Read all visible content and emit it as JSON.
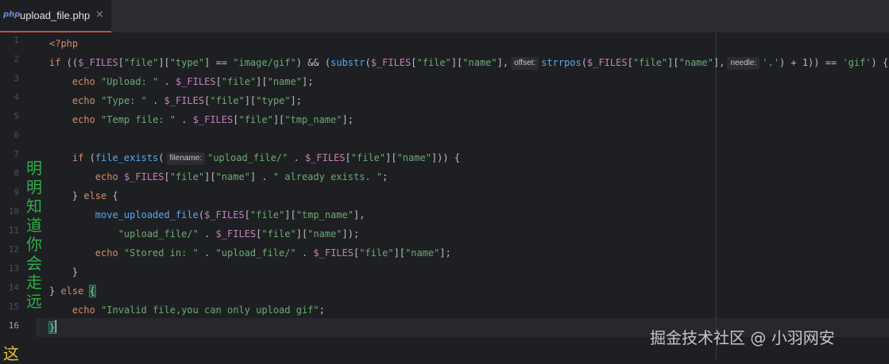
{
  "tab": {
    "icon_text": "php",
    "file_name": "upload_file.php",
    "close_glyph": "×"
  },
  "gutter": {
    "line_numbers": [
      "1",
      "2",
      "3",
      "4",
      "5",
      "6",
      "7",
      "8",
      "9",
      "10",
      "11",
      "12",
      "13",
      "14",
      "15",
      "16"
    ],
    "current_line": "16"
  },
  "code": {
    "l1": "<?php",
    "l2_if": "if",
    "l2_a": " ((",
    "l2_var1": "$_FILES",
    "l2_b": "[",
    "l2_s1": "\"file\"",
    "l2_c": "][",
    "l2_s2": "\"type\"",
    "l2_d": "] == ",
    "l2_s3": "\"image/gif\"",
    "l2_e": ") && (",
    "l2_fn1": "substr",
    "l2_f": "(",
    "l2_var2": "$_FILES",
    "l2_g": "[",
    "l2_s4": "\"file\"",
    "l2_h": "][",
    "l2_s5": "\"name\"",
    "l2_i": "],",
    "l2_hint1": "offset:",
    "l2_fn2": "strrpos",
    "l2_j": "(",
    "l2_var3": "$_FILES",
    "l2_k": "[",
    "l2_s6": "\"file\"",
    "l2_l": "][",
    "l2_s7": "\"name\"",
    "l2_m": "],",
    "l2_hint2": "needle:",
    "l2_s8": "'.'",
    "l2_n": ") + 1)) == ",
    "l2_s9": "'gif'",
    "l2_o": ") {",
    "l3_kw": "echo",
    "l3_s1": "\"Upload: \"",
    "l3_a": " . ",
    "l3_var": "$_FILES",
    "l3_b": "[",
    "l3_s2": "\"file\"",
    "l3_c": "][",
    "l3_s3": "\"name\"",
    "l3_d": "];",
    "l4_kw": "echo",
    "l4_s1": "\"Type: \"",
    "l4_a": " . ",
    "l4_var": "$_FILES",
    "l4_b": "[",
    "l4_s2": "\"file\"",
    "l4_c": "][",
    "l4_s3": "\"type\"",
    "l4_d": "];",
    "l5_kw": "echo",
    "l5_s1": "\"Temp file: \"",
    "l5_a": " . ",
    "l5_var": "$_FILES",
    "l5_b": "[",
    "l5_s2": "\"file\"",
    "l5_c": "][",
    "l5_s3": "\"tmp_name\"",
    "l5_d": "];",
    "l7_kw": "if",
    "l7_a": " (",
    "l7_fn": "file_exists",
    "l7_b": "(",
    "l7_hint": "filename:",
    "l7_s1": "\"upload_file/\"",
    "l7_c": " . ",
    "l7_var": "$_FILES",
    "l7_d": "[",
    "l7_s2": "\"file\"",
    "l7_e": "][",
    "l7_s3": "\"name\"",
    "l7_f": "])) {",
    "l8_kw": "echo",
    "l8_var": "$_FILES",
    "l8_a": "[",
    "l8_s1": "\"file\"",
    "l8_b": "][",
    "l8_s2": "\"name\"",
    "l8_c": "] . ",
    "l8_s3": "\" already exists. \"",
    "l8_d": ";",
    "l9_a": "} ",
    "l9_kw": "else",
    "l9_b": " {",
    "l10_fn": "move_uploaded_file",
    "l10_a": "(",
    "l10_var": "$_FILES",
    "l10_b": "[",
    "l10_s1": "\"file\"",
    "l10_c": "][",
    "l10_s2": "\"tmp_name\"",
    "l10_d": "],",
    "l11_s1": "\"upload_file/\"",
    "l11_a": " . ",
    "l11_var": "$_FILES",
    "l11_b": "[",
    "l11_s2": "\"file\"",
    "l11_c": "][",
    "l11_s3": "\"name\"",
    "l11_d": "]);",
    "l12_kw": "echo",
    "l12_s1": "\"Stored in: \"",
    "l12_a": " . ",
    "l12_s2": "\"upload_file/\"",
    "l12_b": " . ",
    "l12_var": "$_FILES",
    "l12_c": "[",
    "l12_s3": "\"file\"",
    "l12_d": "][",
    "l12_s4": "\"name\"",
    "l12_e": "];",
    "l13": "}",
    "l14_a": "} ",
    "l14_kw": "else",
    "l14_b": " ",
    "l14_brace": "{",
    "l15_kw": "echo",
    "l15_s1": "\"Invalid file,you can only upload gif\"",
    "l15_a": ";",
    "l16_brace": "}"
  },
  "overlay": {
    "side_text": "明明知道你会走远",
    "corner_char": "这",
    "watermark": "掘金技术社区 @ 小羽网安"
  }
}
